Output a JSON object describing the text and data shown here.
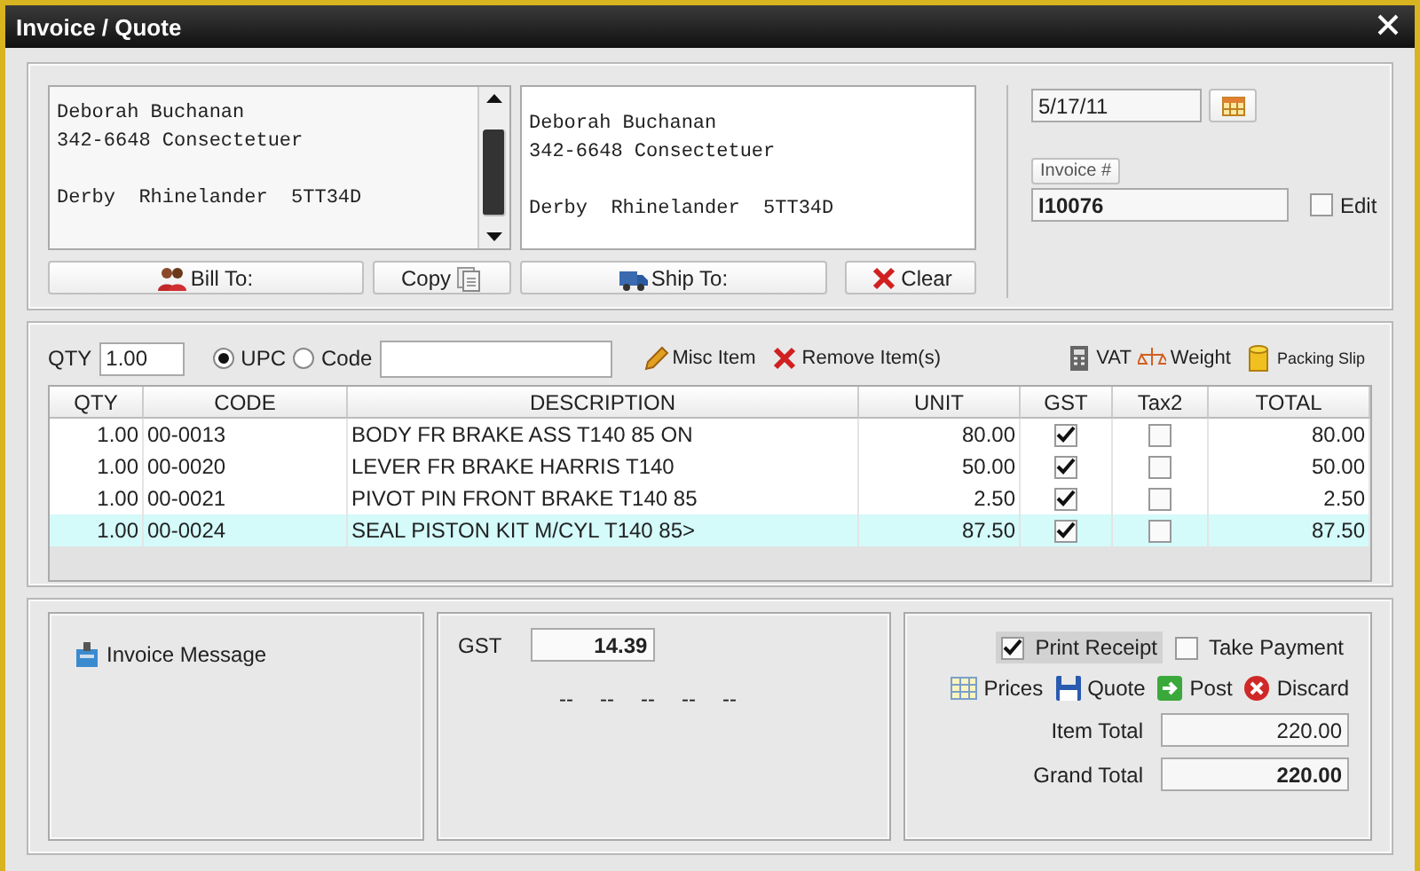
{
  "window": {
    "title": "Invoice / Quote"
  },
  "bill_to": {
    "address": "Deborah Buchanan\n342-6648 Consectetuer\n\nDerby  Rhinelander  5TT34D"
  },
  "ship_to": {
    "address": "Deborah Buchanan\n342-6648 Consectetuer\n\nDerby  Rhinelander  5TT34D"
  },
  "address_buttons": [
    {
      "label": "Bill To:"
    },
    {
      "label": "Copy"
    },
    {
      "label": "Ship To:"
    },
    {
      "label": "Clear"
    }
  ],
  "date": {
    "value": "5/17/11"
  },
  "invoice": {
    "label": "Invoice #",
    "value": "I10076",
    "edit_label": "Edit",
    "edit_checked": false
  },
  "entry": {
    "qty_label": "QTY",
    "qty": "1.00",
    "modes": [
      {
        "label": "UPC",
        "selected": true
      },
      {
        "label": "Code",
        "selected": false
      }
    ]
  },
  "tools": [
    {
      "label": "Misc Item"
    },
    {
      "label": "Remove Item(s)"
    },
    {
      "label": "VAT"
    },
    {
      "label": "Weight"
    },
    {
      "label": "Packing Slip"
    }
  ],
  "table": {
    "columns": [
      "QTY",
      "CODE",
      "DESCRIPTION",
      "UNIT",
      "GST",
      "Tax2",
      "TOTAL"
    ],
    "rows": [
      {
        "qty": "1.00",
        "code": "00-0013",
        "description": "BODY FR BRAKE ASS T140 85 ON",
        "unit": "80.00",
        "gst": true,
        "tax2": false,
        "total": "80.00",
        "selected": false
      },
      {
        "qty": "1.00",
        "code": "00-0020",
        "description": "LEVER FR BRAKE HARRIS T140",
        "unit": "50.00",
        "gst": true,
        "tax2": false,
        "total": "50.00",
        "selected": false
      },
      {
        "qty": "1.00",
        "code": "00-0021",
        "description": "PIVOT PIN FRONT BRAKE T140 85",
        "unit": "2.50",
        "gst": true,
        "tax2": false,
        "total": "2.50",
        "selected": false
      },
      {
        "qty": "1.00",
        "code": "00-0024",
        "description": "SEAL PISTON KIT M/CYL T140 85>",
        "unit": "87.50",
        "gst": true,
        "tax2": false,
        "total": "87.50",
        "selected": true
      }
    ]
  },
  "message": {
    "label": "Invoice Message"
  },
  "tax": {
    "label": "GST",
    "value": "14.39",
    "placeholders": [
      "--",
      "--",
      "--",
      "--",
      "--"
    ]
  },
  "options": [
    {
      "label": "Print Receipt",
      "checked": true
    },
    {
      "label": "Take Payment",
      "checked": false
    }
  ],
  "actions": [
    {
      "label": "Prices"
    },
    {
      "label": "Quote"
    },
    {
      "label": "Post"
    },
    {
      "label": "Discard"
    }
  ],
  "totals": [
    {
      "label": "Item Total",
      "value": "220.00"
    },
    {
      "label": "Grand Total",
      "value": "220.00"
    }
  ]
}
